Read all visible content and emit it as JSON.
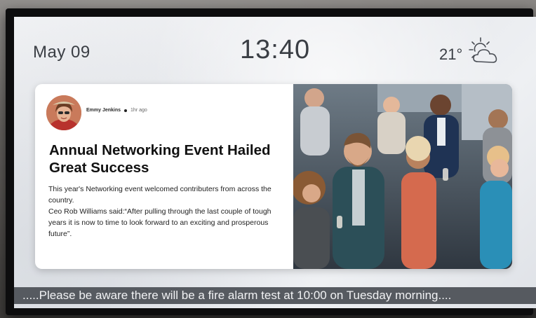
{
  "header": {
    "date": "May 09",
    "time": "13:40",
    "temperature": "21°",
    "weather_icon": "partly-cloudy-icon"
  },
  "article": {
    "author": "Emmy Jenkins",
    "posted_ago": "1hr ago",
    "headline": "Annual Networking Event Hailed Great Success",
    "paragraphs": [
      "This year's Networking event welcomed contributers from across the country.",
      "Ceo Rob Williams said:“After pulling through the last couple of tough years it is now to time to look forward to an exciting and prosperous future”."
    ],
    "photo_subject": "networking-event-crowd-photo"
  },
  "ticker": {
    "text": ".....Please be aware there will be a fire alarm test at 10:00 on Tuesday morning...."
  },
  "colors": {
    "screen_bg": "#eef0f3",
    "text": "#3a3e44",
    "ticker_bg": "#565a60",
    "card_bg": "#ffffff"
  }
}
